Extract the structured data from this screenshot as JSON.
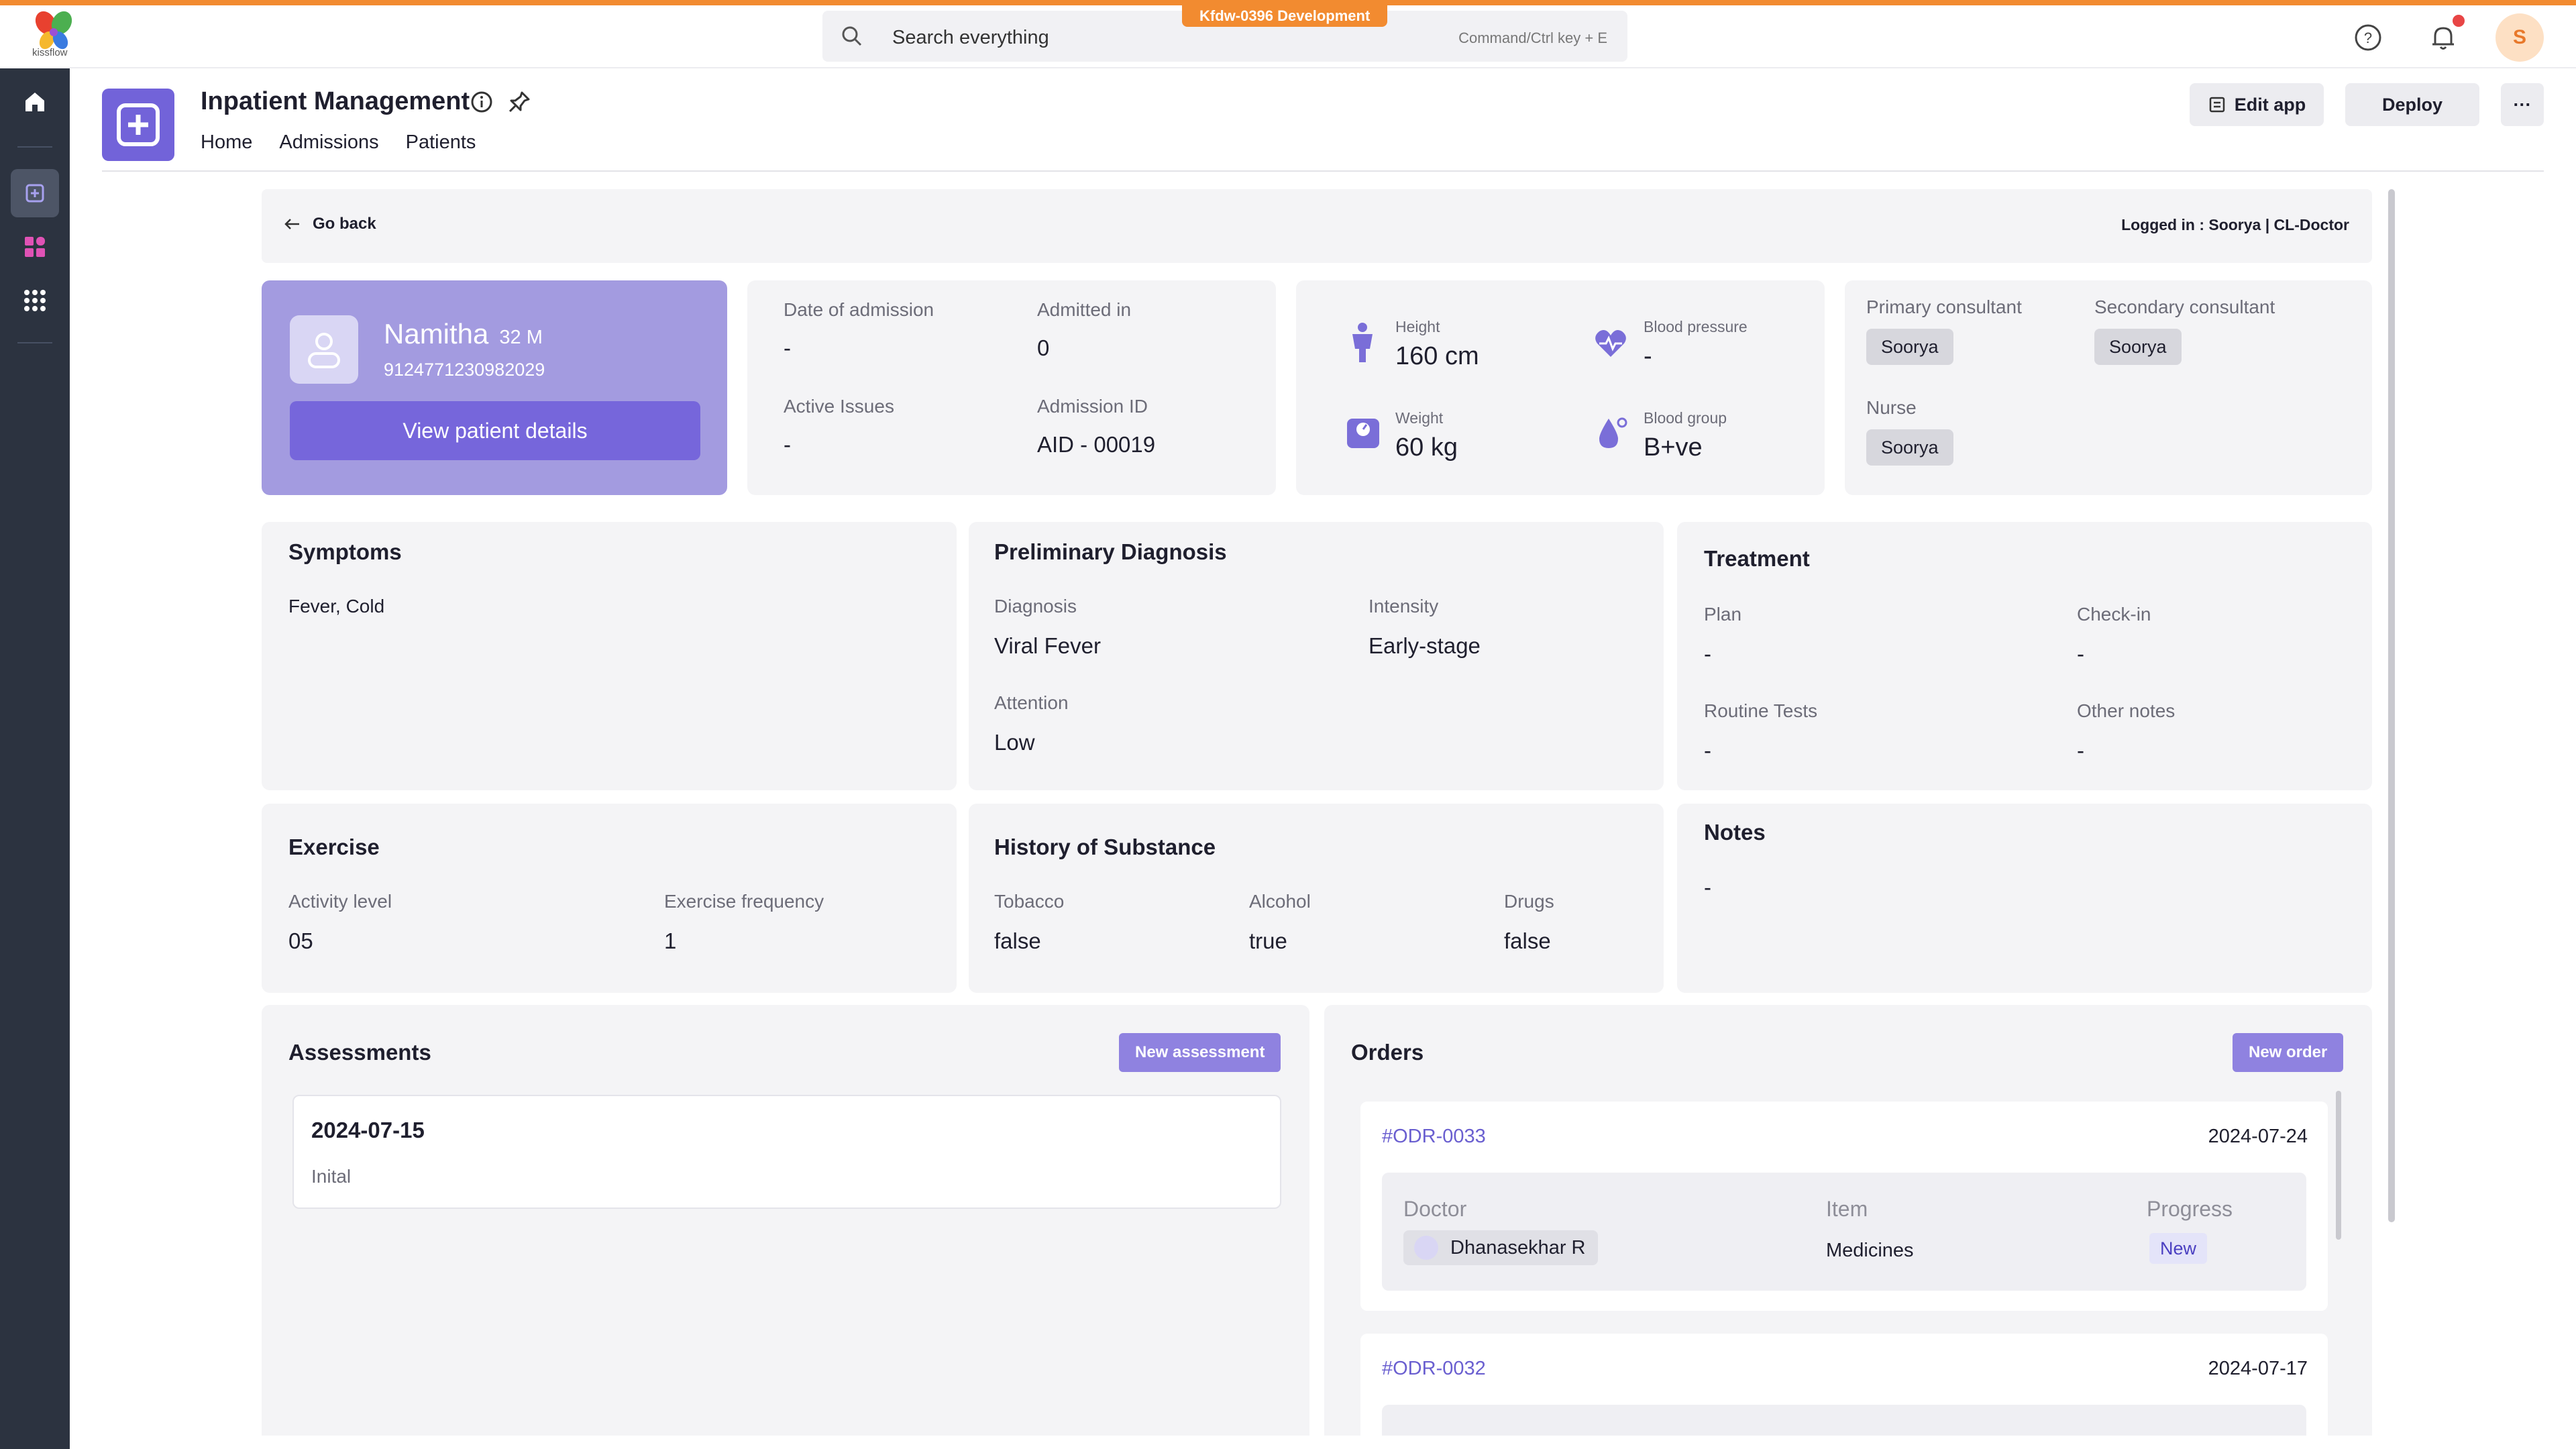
{
  "env_badge": "Kfdw-0396 Development",
  "logo_text": "kissflow",
  "search": {
    "placeholder": "Search everything",
    "hint": "Command/Ctrl key + E"
  },
  "user": {
    "initial": "S"
  },
  "app": {
    "title": "Inpatient Management",
    "nav": [
      "Home",
      "Admissions",
      "Patients"
    ],
    "edit_label": "Edit app",
    "deploy_label": "Deploy",
    "more_label": "···"
  },
  "go_back": "Go back",
  "logged_in": "Logged in : Soorya | CL-Doctor",
  "patient": {
    "name": "Namitha",
    "age_gender": "32 M",
    "phone": "9124771230982029",
    "view_button": "View patient details"
  },
  "admission": {
    "date_label": "Date of admission",
    "date_value": "-",
    "admitted_in_label": "Admitted in",
    "admitted_in_value": "0",
    "issues_label": "Active Issues",
    "issues_value": "-",
    "id_label": "Admission ID",
    "id_value": "AID - 00019"
  },
  "vitals": {
    "height_label": "Height",
    "height_value": "160 cm",
    "bp_label": "Blood pressure",
    "bp_value": "-",
    "weight_label": "Weight",
    "weight_value": "60 kg",
    "bg_label": "Blood group",
    "bg_value": "B+ve"
  },
  "staff": {
    "primary_label": "Primary consultant",
    "primary_value": "Soorya",
    "secondary_label": "Secondary consultant",
    "secondary_value": "Soorya",
    "nurse_label": "Nurse",
    "nurse_value": "Soorya"
  },
  "symptoms": {
    "title": "Symptoms",
    "value": "Fever, Cold"
  },
  "diagnosis": {
    "title": "Preliminary Diagnosis",
    "diagnosis_label": "Diagnosis",
    "diagnosis_value": "Viral Fever",
    "intensity_label": "Intensity",
    "intensity_value": "Early-stage",
    "attention_label": "Attention",
    "attention_value": "Low"
  },
  "treatment": {
    "title": "Treatment",
    "plan_label": "Plan",
    "plan_value": "-",
    "checkin_label": "Check-in",
    "checkin_value": "-",
    "tests_label": "Routine Tests",
    "tests_value": "-",
    "notes_label": "Other notes",
    "notes_value": "-"
  },
  "exercise": {
    "title": "Exercise",
    "activity_label": "Activity level",
    "activity_value": "05",
    "frequency_label": "Exercise frequency",
    "frequency_value": "1"
  },
  "substance": {
    "title": "History of Substance",
    "tobacco_label": "Tobacco",
    "tobacco_value": "false",
    "alcohol_label": "Alcohol",
    "alcohol_value": "true",
    "drugs_label": "Drugs",
    "drugs_value": "false"
  },
  "notes": {
    "title": "Notes",
    "value": "-"
  },
  "assessments": {
    "title": "Assessments",
    "new_button": "New assessment",
    "items": [
      {
        "date": "2024-07-15",
        "type": "Inital"
      }
    ]
  },
  "orders": {
    "title": "Orders",
    "new_button": "New order",
    "col_doctor": "Doctor",
    "col_item": "Item",
    "col_progress": "Progress",
    "items": [
      {
        "id": "#ODR-0033",
        "date": "2024-07-24",
        "doctor": "Dhanasekhar R",
        "item": "Medicines",
        "progress": "New"
      },
      {
        "id": "#ODR-0032",
        "date": "2024-07-17"
      }
    ]
  },
  "colors": {
    "accent": "#f28b30",
    "brand_purple": "#7263d9",
    "patient_card": "#a39be0",
    "rail": "#2c3340"
  }
}
